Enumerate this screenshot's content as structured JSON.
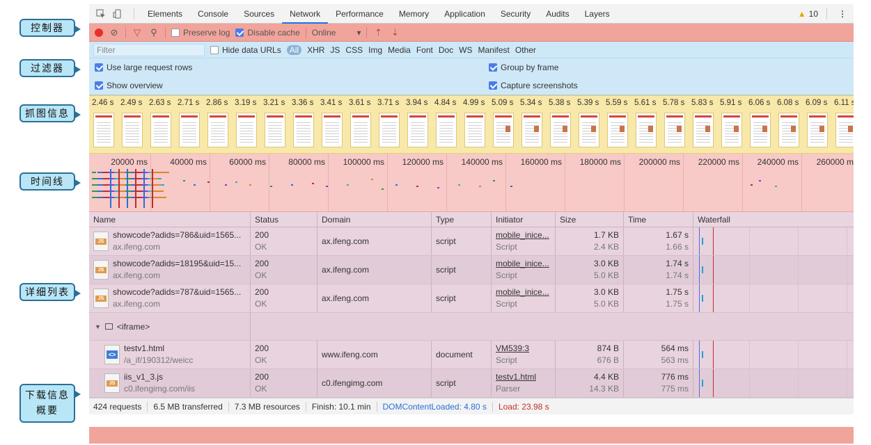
{
  "callouts": {
    "controller": "控制器",
    "filter": "过滤器",
    "screenshots": "抓图信息",
    "timeline": "时间线",
    "list": "详细列表",
    "summary_line1": "下载信息",
    "summary_line2": "概要"
  },
  "tabs": [
    "Elements",
    "Console",
    "Sources",
    "Network",
    "Performance",
    "Memory",
    "Application",
    "Security",
    "Audits",
    "Layers"
  ],
  "active_tab": "Network",
  "warnings_count": "10",
  "controls": {
    "preserve_log": "Preserve log",
    "disable_cache": "Disable cache",
    "throttle": "Online"
  },
  "filter": {
    "placeholder": "Filter",
    "hide_data_urls": "Hide data URLs",
    "types": [
      "All",
      "XHR",
      "JS",
      "CSS",
      "Img",
      "Media",
      "Font",
      "Doc",
      "WS",
      "Manifest",
      "Other"
    ]
  },
  "options": {
    "large_rows": "Use large request rows",
    "group_by_frame": "Group by frame",
    "show_overview": "Show overview",
    "capture_screenshots": "Capture screenshots"
  },
  "screenshot_times": [
    "2.46 s",
    "2.49 s",
    "2.63 s",
    "2.71 s",
    "2.86 s",
    "3.19 s",
    "3.21 s",
    "3.36 s",
    "3.41 s",
    "3.61 s",
    "3.71 s",
    "3.94 s",
    "4.84 s",
    "4.99 s",
    "5.09 s",
    "5.34 s",
    "5.38 s",
    "5.39 s",
    "5.59 s",
    "5.61 s",
    "5.78 s",
    "5.83 s",
    "5.91 s",
    "6.06 s",
    "6.08 s",
    "6.09 s",
    "6.11 s"
  ],
  "timeline_labels": [
    "20000 ms",
    "40000 ms",
    "60000 ms",
    "80000 ms",
    "100000 ms",
    "120000 ms",
    "140000 ms",
    "160000 ms",
    "180000 ms",
    "200000 ms",
    "220000 ms",
    "240000 ms",
    "260000 ms"
  ],
  "columns": [
    "Name",
    "Status",
    "Domain",
    "Type",
    "Initiator",
    "Size",
    "Time",
    "Waterfall"
  ],
  "rows": [
    {
      "name": "showcode?adids=786&uid=1565...",
      "host": "ax.ifeng.com",
      "status": "200",
      "status_text": "OK",
      "domain": "ax.ifeng.com",
      "type": "script",
      "initiator": "mobile_inice...",
      "initiator_type": "Script",
      "size": "1.7 KB",
      "size2": "2.4 KB",
      "time": "1.67 s",
      "time2": "1.66 s",
      "icon": "JS"
    },
    {
      "name": "showcode?adids=18195&uid=15...",
      "host": "ax.ifeng.com",
      "status": "200",
      "status_text": "OK",
      "domain": "ax.ifeng.com",
      "type": "script",
      "initiator": "mobile_inice...",
      "initiator_type": "Script",
      "size": "3.0 KB",
      "size2": "5.0 KB",
      "time": "1.74 s",
      "time2": "1.74 s",
      "icon": "JS"
    },
    {
      "name": "showcode?adids=787&uid=1565...",
      "host": "ax.ifeng.com",
      "status": "200",
      "status_text": "OK",
      "domain": "ax.ifeng.com",
      "type": "script",
      "initiator": "mobile_inice...",
      "initiator_type": "Script",
      "size": "3.0 KB",
      "size2": "5.0 KB",
      "time": "1.75 s",
      "time2": "1.75 s",
      "icon": "JS"
    }
  ],
  "group_label": "<iframe>",
  "group_rows": [
    {
      "name": "testv1.html",
      "host": "/a_if/190312/weicc",
      "status": "200",
      "status_text": "OK",
      "domain": "www.ifeng.com",
      "type": "document",
      "initiator": "VM539:3",
      "initiator_type": "Script",
      "size": "874 B",
      "size2": "676 B",
      "time": "564 ms",
      "time2": "563 ms",
      "icon": "<>"
    },
    {
      "name": "iis_v1_3.js",
      "host": "c0.ifengimg.com/iis",
      "status": "200",
      "status_text": "OK",
      "domain": "c0.ifengimg.com",
      "type": "script",
      "initiator": "testv1.html",
      "initiator_type": "Parser",
      "size": "4.4 KB",
      "size2": "14.3 KB",
      "time": "776 ms",
      "time2": "775 ms",
      "icon": "JS"
    }
  ],
  "summary": {
    "requests": "424 requests",
    "transferred": "6.5 MB transferred",
    "resources": "7.3 MB resources",
    "finish": "Finish: 10.1 min",
    "dcl": "DOMContentLoaded: 4.80 s",
    "load": "Load: 23.98 s"
  },
  "colors": {
    "controls": "#f1a49b",
    "filter": "#cfe8f7",
    "screenshots": "#f8e8a9",
    "timeline": "#f7c9c7",
    "table": "#e8d3de"
  }
}
